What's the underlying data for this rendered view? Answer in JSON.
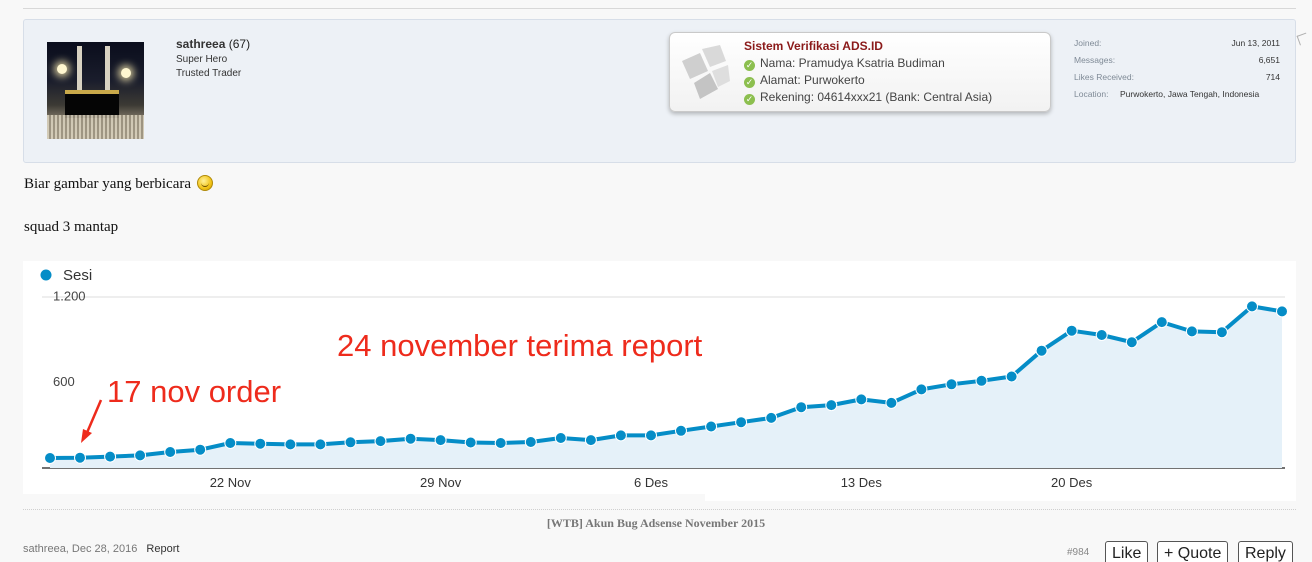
{
  "post": {
    "user": {
      "name": "sathreea",
      "count": "(67)",
      "title": "Super Hero",
      "rank": "Trusted Trader"
    },
    "verification": {
      "title": "Sistem Verifikasi ADS.ID",
      "rows": [
        "Nama: Pramudya Ksatria Budiman",
        "Alamat: Purwokerto",
        "Rekening: 04614xxx21 (Bank: Central Asia)"
      ]
    },
    "stats": {
      "joined_label": "Joined:",
      "joined_value": "Jun 13, 2011",
      "messages_label": "Messages:",
      "messages_value": "6,651",
      "likes_label": "Likes Received:",
      "likes_value": "714",
      "location_label": "Location:",
      "location_value": "Purwokerto, Jawa Tengah, Indonesia"
    },
    "message": {
      "line1": "Biar gambar yang berbicara",
      "line2": "squad 3 mantap"
    },
    "signature": "[WTB] Akun Bug Adsense November 2015",
    "footer": {
      "author_date": "sathreea, Dec 28, 2016",
      "report": "Report",
      "post_number": "#984",
      "like": "Like",
      "quote": "+ Quote",
      "reply": "Reply"
    }
  },
  "colors": {
    "line": "#058dc7",
    "area": "#e5f1f9",
    "annotation": "#ee2b1c",
    "verify_title": "#8b1a1a"
  },
  "chart_data": {
    "type": "area",
    "legend": "Sesi",
    "legend_position": "top-left",
    "ylim": [
      0,
      1300
    ],
    "yticks": [
      600,
      1200
    ],
    "ytick_labels": [
      "600",
      "1.200"
    ],
    "xtick_labels": [
      "22 Nov",
      "29 Nov",
      "6 Des",
      "13 Des",
      "20 Des"
    ],
    "xtick_index": [
      6,
      13,
      20,
      27,
      34
    ],
    "grid": false,
    "series": [
      {
        "name": "Sesi",
        "values": [
          70,
          72,
          80,
          88,
          112,
          128,
          175,
          170,
          165,
          165,
          180,
          188,
          205,
          195,
          178,
          175,
          182,
          210,
          195,
          228,
          228,
          260,
          290,
          320,
          350,
          425,
          440,
          480,
          455,
          550,
          585,
          610,
          640,
          820,
          960,
          930,
          880,
          1020,
          955,
          950,
          1130,
          1095
        ]
      }
    ],
    "annotations": [
      "17 nov order",
      "24 november terima report"
    ]
  }
}
